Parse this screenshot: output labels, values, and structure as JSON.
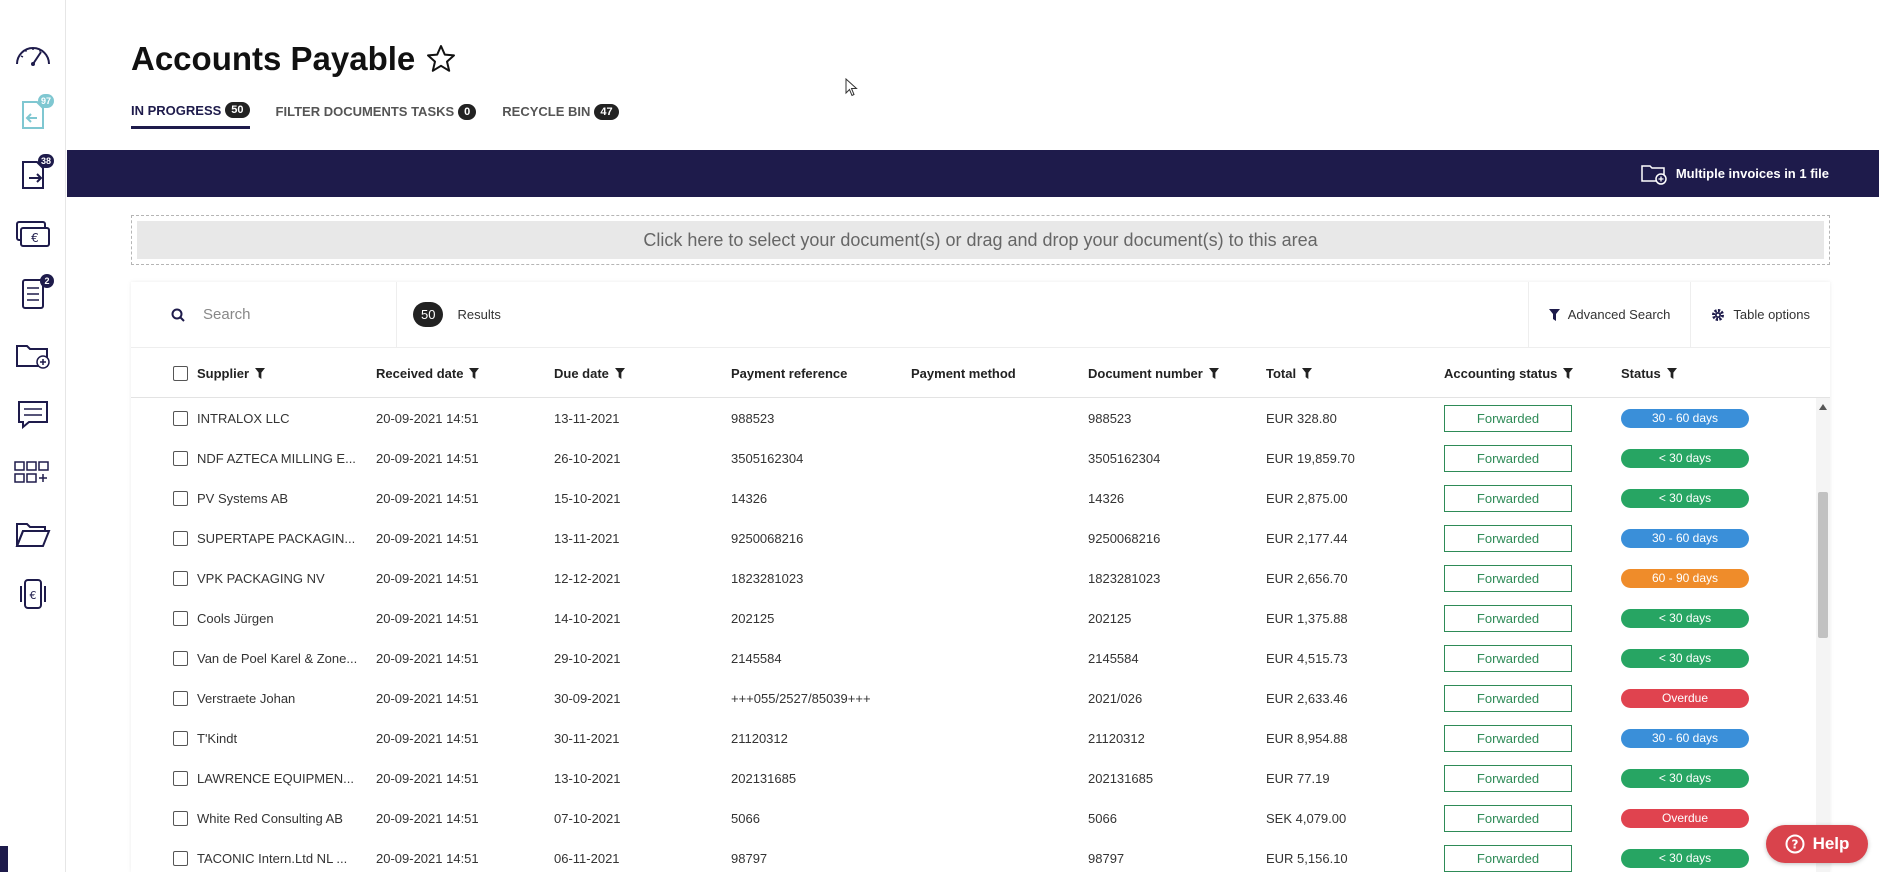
{
  "sidebar": {
    "items": [
      {
        "icon": "dashboard-gauge-icon",
        "badge": ""
      },
      {
        "icon": "incoming-documents-icon",
        "badge": "97"
      },
      {
        "icon": "outgoing-documents-icon",
        "badge": "38"
      },
      {
        "icon": "payments-euro-icon",
        "badge": ""
      },
      {
        "icon": "tasks-list-icon",
        "badge": "2"
      },
      {
        "icon": "folder-add-icon",
        "badge": ""
      },
      {
        "icon": "messages-icon",
        "badge": ""
      },
      {
        "icon": "apps-grid-icon",
        "badge": ""
      },
      {
        "icon": "folder-open-icon",
        "badge": ""
      },
      {
        "icon": "euro-phone-icon",
        "badge": ""
      }
    ]
  },
  "header": {
    "title": "Accounts Payable",
    "tabs": [
      {
        "label": "IN PROGRESS",
        "count": "50"
      },
      {
        "label": "FILTER DOCUMENTS TASKS",
        "count": "0"
      },
      {
        "label": "RECYCLE BIN",
        "count": "47"
      }
    ]
  },
  "banner": {
    "multiple_invoices_label": "Multiple invoices in 1 file"
  },
  "dropzone": {
    "text": "Click here to select your document(s) or drag and drop your document(s) to this area"
  },
  "toolbar": {
    "search_placeholder": "Search",
    "results_count": "50",
    "results_label": "Results",
    "advanced_search_label": "Advanced Search",
    "table_options_label": "Table options"
  },
  "table": {
    "columns": {
      "supplier": "Supplier",
      "received_date": "Received date",
      "due_date": "Due date",
      "payment_reference": "Payment reference",
      "payment_method": "Payment method",
      "document_number": "Document number",
      "total": "Total",
      "accounting_status": "Accounting status",
      "status": "Status"
    },
    "rows": [
      {
        "supplier": "INTRALOX LLC",
        "received": "20-09-2021 14:51",
        "due": "13-11-2021",
        "payref": "988523",
        "method": "",
        "docnum": "988523",
        "total": "EUR 328.80",
        "acc": "Forwarded",
        "status": "30 - 60 days",
        "status_color": "#3a8fd9"
      },
      {
        "supplier": "NDF AZTECA MILLING E...",
        "received": "20-09-2021 14:51",
        "due": "26-10-2021",
        "payref": "3505162304",
        "method": "",
        "docnum": "3505162304",
        "total": "EUR 19,859.70",
        "acc": "Forwarded",
        "status": "< 30 days",
        "status_color": "#27a563"
      },
      {
        "supplier": "PV Systems AB",
        "received": "20-09-2021 14:51",
        "due": "15-10-2021",
        "payref": "14326",
        "method": "",
        "docnum": "14326",
        "total": "EUR 2,875.00",
        "acc": "Forwarded",
        "status": "< 30 days",
        "status_color": "#27a563"
      },
      {
        "supplier": "SUPERTAPE PACKAGIN...",
        "received": "20-09-2021 14:51",
        "due": "13-11-2021",
        "payref": "9250068216",
        "method": "",
        "docnum": "9250068216",
        "total": "EUR 2,177.44",
        "acc": "Forwarded",
        "status": "30 - 60 days",
        "status_color": "#3a8fd9"
      },
      {
        "supplier": "VPK PACKAGING NV",
        "received": "20-09-2021 14:51",
        "due": "12-12-2021",
        "payref": "1823281023",
        "method": "",
        "docnum": "1823281023",
        "total": "EUR 2,656.70",
        "acc": "Forwarded",
        "status": "60 - 90 days",
        "status_color": "#ef8c2a"
      },
      {
        "supplier": "Cools Jürgen",
        "received": "20-09-2021 14:51",
        "due": "14-10-2021",
        "payref": "202125",
        "method": "",
        "docnum": "202125",
        "total": "EUR 1,375.88",
        "acc": "Forwarded",
        "status": "< 30 days",
        "status_color": "#27a563"
      },
      {
        "supplier": "Van de Poel Karel & Zone...",
        "received": "20-09-2021 14:51",
        "due": "29-10-2021",
        "payref": "2145584",
        "method": "",
        "docnum": "2145584",
        "total": "EUR 4,515.73",
        "acc": "Forwarded",
        "status": "< 30 days",
        "status_color": "#27a563"
      },
      {
        "supplier": "Verstraete Johan",
        "received": "20-09-2021 14:51",
        "due": "30-09-2021",
        "payref": "+++055/2527/85039+++",
        "method": "",
        "docnum": "2021/026",
        "total": "EUR 2,633.46",
        "acc": "Forwarded",
        "status": "Overdue",
        "status_color": "#e0434f"
      },
      {
        "supplier": "T'Kindt",
        "received": "20-09-2021 14:51",
        "due": "30-11-2021",
        "payref": "21120312",
        "method": "",
        "docnum": "21120312",
        "total": "EUR 8,954.88",
        "acc": "Forwarded",
        "status": "30 - 60 days",
        "status_color": "#3a8fd9"
      },
      {
        "supplier": "LAWRENCE EQUIPMEN...",
        "received": "20-09-2021 14:51",
        "due": "13-10-2021",
        "payref": "202131685",
        "method": "",
        "docnum": "202131685",
        "total": "EUR 77.19",
        "acc": "Forwarded",
        "status": "< 30 days",
        "status_color": "#27a563"
      },
      {
        "supplier": "White Red Consulting AB",
        "received": "20-09-2021 14:51",
        "due": "07-10-2021",
        "payref": "5066",
        "method": "",
        "docnum": "5066",
        "total": "SEK 4,079.00",
        "acc": "Forwarded",
        "status": "Overdue",
        "status_color": "#e0434f"
      },
      {
        "supplier": "TACONIC Intern.Ltd NL ...",
        "received": "20-09-2021 14:51",
        "due": "06-11-2021",
        "payref": "98797",
        "method": "",
        "docnum": "98797",
        "total": "EUR 5,156.10",
        "acc": "Forwarded",
        "status": "< 30 days",
        "status_color": "#27a563"
      }
    ]
  },
  "help": {
    "label": "Help"
  },
  "colors": {
    "brand": "#1e1b4b",
    "forwarded": "#2e8b57",
    "help": "#d9434c"
  }
}
